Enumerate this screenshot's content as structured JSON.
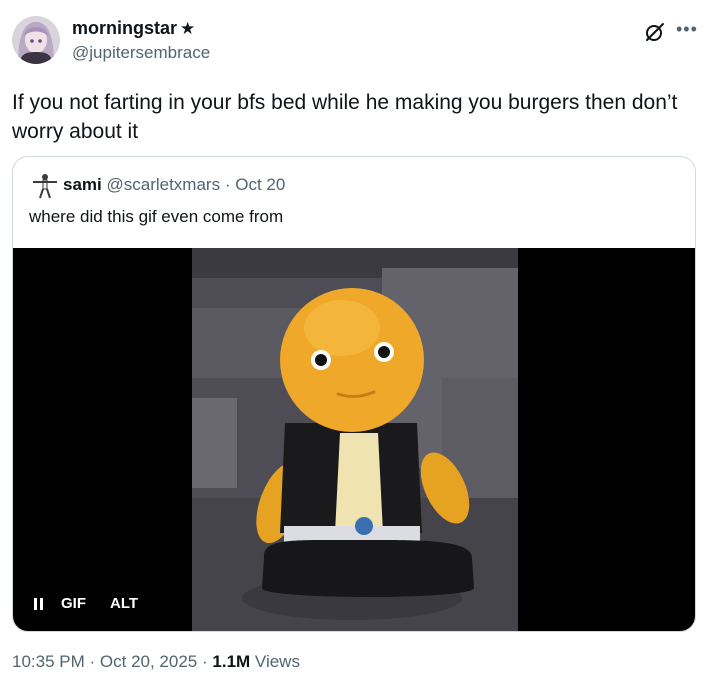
{
  "author": {
    "display_name": "morningstar",
    "badge": "★",
    "handle": "@jupitersembrace"
  },
  "tweet": {
    "text": "If you not farting in your bfs bed while he making you burgers then don’t worry about it"
  },
  "quoted_tweet": {
    "display_name": "sami",
    "handle": "@scarletxmars",
    "separator": "·",
    "date": "Oct 20",
    "text": "where did this gif even come from"
  },
  "media": {
    "type_label": "GIF",
    "alt_label": "ALT"
  },
  "meta": {
    "time": "10:35 PM",
    "sep1": "·",
    "date": "Oct 20, 2025",
    "sep2": "·",
    "views_count": "1.1M",
    "views_label": "Views"
  },
  "icons": {
    "grok": "grok-icon",
    "more": "more-icon",
    "pause": "pause-icon"
  }
}
